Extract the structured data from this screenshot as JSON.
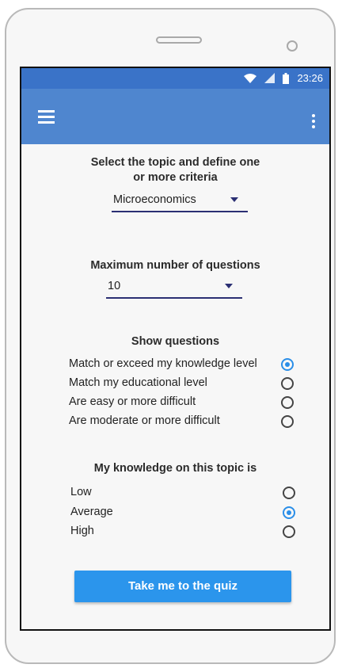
{
  "status_bar": {
    "time": "23:26",
    "icons": [
      "wifi-icon",
      "signal-icon",
      "battery-icon"
    ]
  },
  "app_bar": {
    "menu_icon": "hamburger-icon",
    "overflow_icon": "more-vert-icon"
  },
  "topic_section": {
    "heading_line1": "Select the topic and define one",
    "heading_line2": "or more criteria",
    "selected_topic": "Microeconomics"
  },
  "max_questions_section": {
    "heading": "Maximum number of questions",
    "selected_value": "10"
  },
  "show_questions_section": {
    "heading": "Show questions",
    "options": [
      {
        "label": "Match or exceed my knowledge level",
        "selected": true
      },
      {
        "label": "Match my educational level",
        "selected": false
      },
      {
        "label": "Are easy or more difficult",
        "selected": false
      },
      {
        "label": "Are moderate or more difficult",
        "selected": false
      }
    ]
  },
  "knowledge_section": {
    "heading": "My knowledge on this topic is",
    "options": [
      {
        "label": "Low",
        "selected": false
      },
      {
        "label": "Average",
        "selected": true
      },
      {
        "label": "High",
        "selected": false
      }
    ]
  },
  "cta_label": "Take me to the quiz",
  "colors": {
    "app_bar": "#4f86cf",
    "status_bar": "#3a73c8",
    "accent": "#2a8ee8",
    "button": "#2b95ec"
  }
}
